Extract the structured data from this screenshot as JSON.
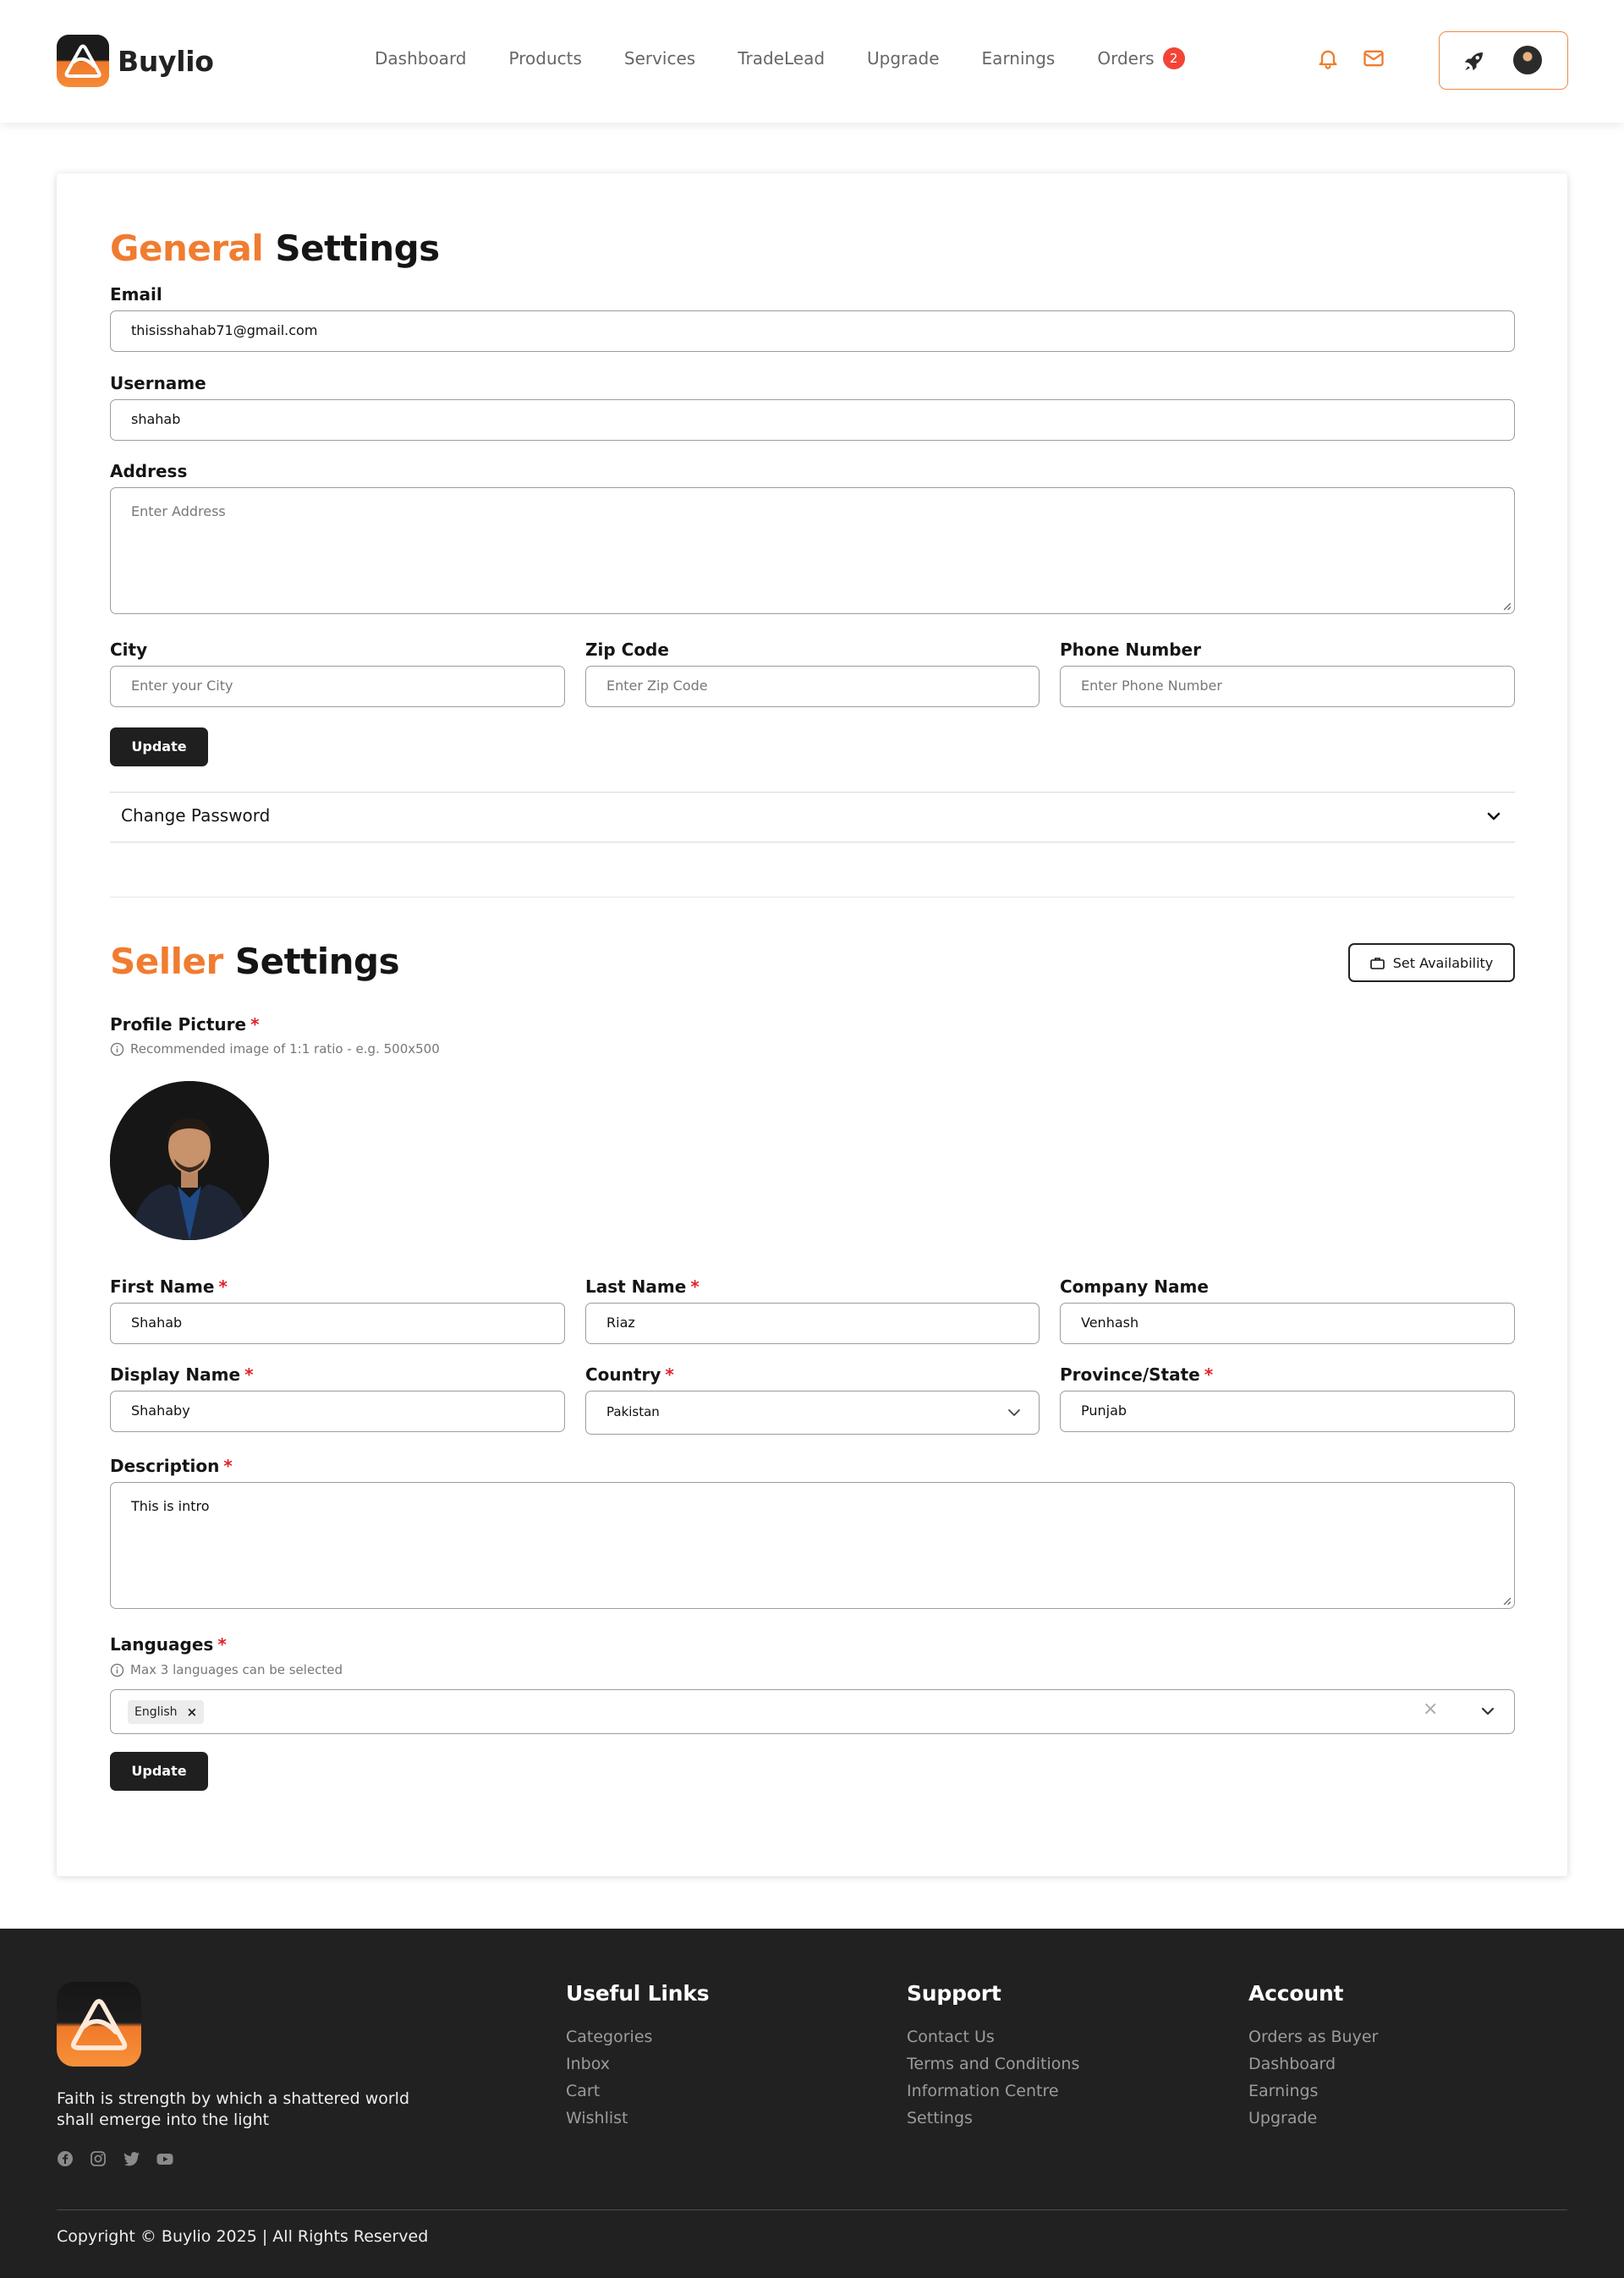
{
  "brand": {
    "name": "Buylio",
    "accent": "#f07c30",
    "dark": "#1f1f1f"
  },
  "nav": {
    "links": [
      "Dashboard",
      "Products",
      "Services",
      "TradeLead",
      "Upgrade",
      "Earnings",
      "Orders"
    ],
    "orders_badge": "2",
    "icons": [
      "bell-icon",
      "mail-icon",
      "rocket-icon"
    ]
  },
  "general": {
    "title_accent": "General",
    "title_rest": "Settings",
    "email_label": "Email",
    "email_value": "thisisshahab71@gmail.com",
    "username_label": "Username",
    "username_value": "shahab",
    "address_label": "Address",
    "address_placeholder": "Enter Address",
    "city_label": "City",
    "city_placeholder": "Enter your City",
    "zip_label": "Zip Code",
    "zip_placeholder": "Enter Zip Code",
    "phone_label": "Phone Number",
    "phone_placeholder": "Enter Phone Number",
    "update_label": "Update",
    "change_password_label": "Change Password"
  },
  "seller": {
    "title_accent": "Seller",
    "title_rest": "Settings",
    "availability_label": "Set Availability",
    "profile_label": "Profile Picture",
    "profile_hint": "Recommended image of 1:1 ratio - e.g. 500x500",
    "required_mark": "*",
    "first_name_label": "First Name",
    "first_name_value": "Shahab",
    "last_name_label": "Last Name",
    "last_name_value": "Riaz",
    "company_label": "Company Name",
    "company_value": "Venhash",
    "display_label": "Display Name",
    "display_value": "Shahaby",
    "country_label": "Country",
    "country_value": "Pakistan",
    "province_label": "Province/State",
    "province_value": "Punjab",
    "description_label": "Description",
    "description_value": "This is intro",
    "languages_label": "Languages",
    "languages_hint": "Max 3 languages can be selected",
    "languages_selected": [
      "English"
    ],
    "chip_remove": "×",
    "clear_all": "×",
    "update_label": "Update"
  },
  "footer": {
    "tagline": "Faith is strength by which a shattered world shall emerge into the light",
    "social_icons": [
      "facebook-icon",
      "instagram-icon",
      "twitter-icon",
      "youtube-icon"
    ],
    "columns": [
      {
        "title": "Useful Links",
        "links": [
          "Categories",
          "Inbox",
          "Cart",
          "Wishlist"
        ]
      },
      {
        "title": "Support",
        "links": [
          "Contact Us",
          "Terms and Conditions",
          "Information Centre",
          "Settings"
        ]
      },
      {
        "title": "Account",
        "links": [
          "Orders as Buyer",
          "Dashboard",
          "Earnings",
          "Upgrade"
        ]
      }
    ],
    "copyright": "Copyright © Buylio 2025 | All Rights Reserved"
  }
}
